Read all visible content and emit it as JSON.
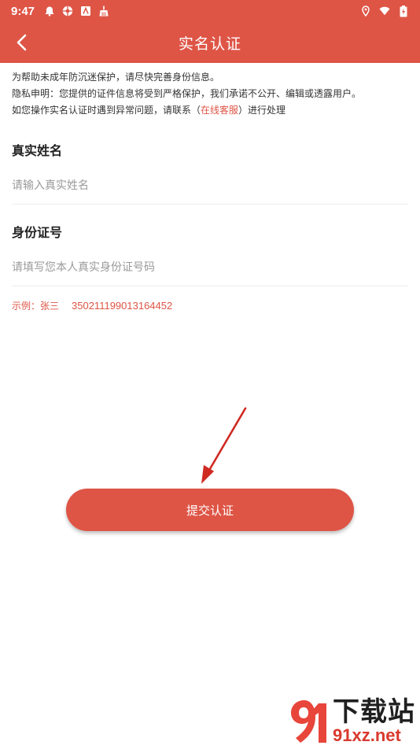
{
  "status_bar": {
    "time": "9:47",
    "left_icons": [
      "notification-bell-icon",
      "aperture-icon",
      "photo-app-icon",
      "cleaner-broom-icon"
    ],
    "right_icons": [
      "location-pin-icon",
      "wifi-icon",
      "battery-icon"
    ]
  },
  "header": {
    "title": "实名认证",
    "back_icon": "chevron-left-icon"
  },
  "notice": {
    "line1": "为帮助未成年防沉迷保护，请尽快完善身份信息。",
    "line2": "隐私申明：您提供的证件信息将受到严格保护，我们承诺不公开、编辑或透露用户。",
    "line3_prefix": "如您操作实名认证时遇到异常问题，请联系（",
    "line3_link": "在线客服",
    "line3_suffix": "）进行处理"
  },
  "form": {
    "name_label": "真实姓名",
    "name_placeholder": "请输入真实姓名",
    "name_value": "",
    "id_label": "身份证号",
    "id_placeholder": "请填写您本人真实身份证号码",
    "id_value": ""
  },
  "example": {
    "prefix": "示例：张三",
    "id_number": "350211199013164452"
  },
  "submit_label": "提交认证",
  "annotation": {
    "arrow_icon": "red-arrow-pointer-icon"
  },
  "watermark": {
    "logo_icon": "91-logo-icon",
    "text": "下载站",
    "url": "91xz.net"
  },
  "colors": {
    "accent": "#de5546",
    "text_primary": "#222222",
    "placeholder": "#9a9a9a"
  }
}
